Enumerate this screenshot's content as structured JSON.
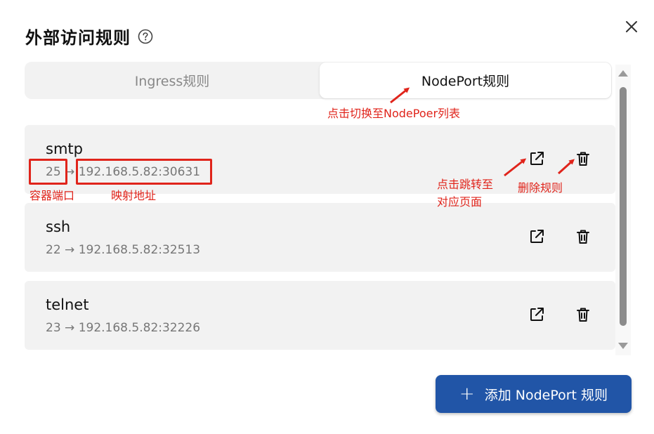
{
  "dialog": {
    "title": "外部访问规则",
    "help_icon": "question-circle-icon",
    "close_icon": "close-icon"
  },
  "tabs": [
    {
      "label": "Ingress规则",
      "active": false
    },
    {
      "label": "NodePort规则",
      "active": true
    }
  ],
  "rules": [
    {
      "name": "smtp",
      "container_port": "25",
      "arrow": "→",
      "mapped_address": "192.168.5.82:30631"
    },
    {
      "name": "ssh",
      "container_port": "22",
      "arrow": "→",
      "mapped_address": "192.168.5.82:32513"
    },
    {
      "name": "telnet",
      "container_port": "23",
      "arrow": "→",
      "mapped_address": "192.168.5.82:32226"
    }
  ],
  "row_actions": {
    "open_icon": "external-link-icon",
    "delete_icon": "trash-icon"
  },
  "add_button": {
    "icon": "+",
    "label": "添加 NodePort 规则"
  },
  "annotations": {
    "switch_tab": "点击切换至NodePoer列表",
    "container_port": "容器端口",
    "mapped_address": "映射地址",
    "jump_line1": "点击跳转至",
    "jump_line2": "对应页面",
    "delete_rule": "删除规则",
    "color": "#e0241b"
  },
  "colors": {
    "primary": "#2155a7",
    "card_bg": "#f2f2f2"
  }
}
